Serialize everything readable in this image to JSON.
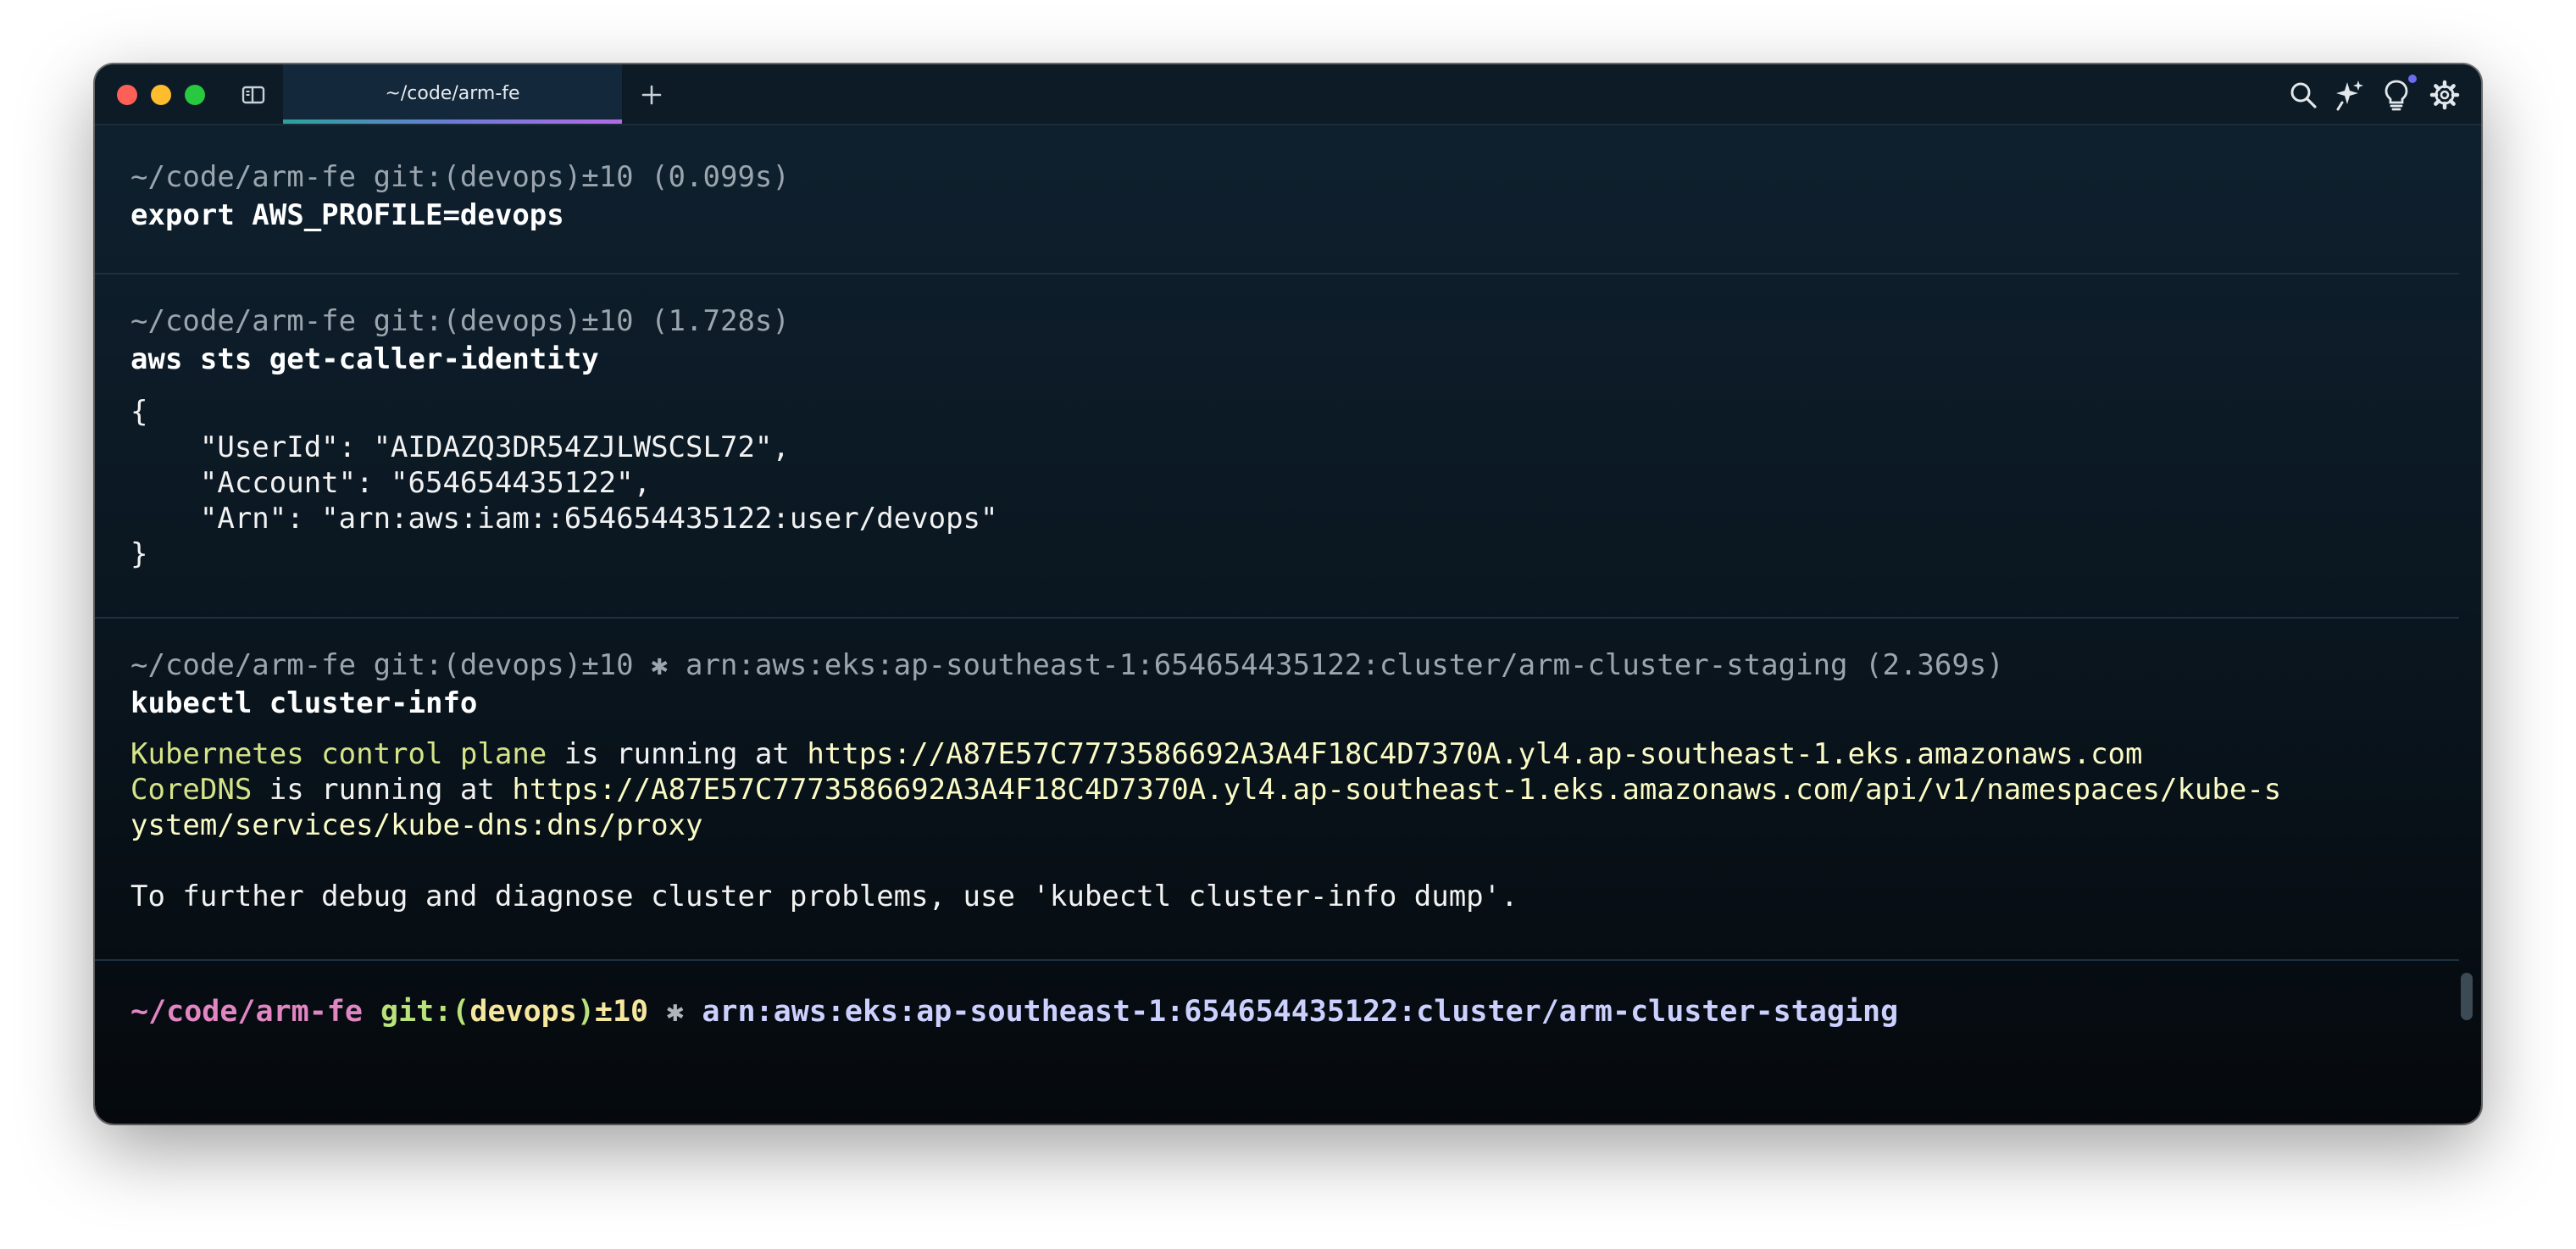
{
  "window": {
    "tab_title": "~/code/arm-fe"
  },
  "icons": {
    "sidebar": "sidebar-toggle-icon",
    "new_tab": "plus-icon",
    "search": "search-icon",
    "ai": "sparkles-icon",
    "tips": "lightbulb-icon",
    "settings": "gear-icon"
  },
  "blocks": [
    {
      "header": "~/code/arm-fe git:(devops)±10 (0.099s)",
      "command": "export AWS_PROFILE=devops"
    },
    {
      "header": "~/code/arm-fe git:(devops)±10 (1.728s)",
      "command": "aws sts get-caller-identity",
      "output": [
        "{",
        "    \"UserId\": \"AIDAZQ3DR54ZJLWSCSL72\",",
        "    \"Account\": \"654654435122\",",
        "    \"Arn\": \"arn:aws:iam::654654435122:user/devops\"",
        "}"
      ]
    },
    {
      "header": "~/code/arm-fe git:(devops)±10 ✱ arn:aws:eks:ap-southeast-1:654654435122:cluster/arm-cluster-staging (2.369s)",
      "command": "kubectl cluster-info",
      "output": {
        "line1_label": "Kubernetes control plane",
        "line1_mid": " is running at ",
        "line1_url": "https://A87E57C7773586692A3A4F18C4D7370A.yl4.ap-southeast-1.eks.amazonaws.com",
        "line2_label": "CoreDNS",
        "line2_mid": " is running at ",
        "line2_url_a": "https://A87E57C7773586692A3A4F18C4D7370A.yl4.ap-southeast-1.eks.amazonaws.com/api/v1/namespaces/kube-s",
        "line2_url_b": "ystem/services/kube-dns:dns/proxy",
        "note": "To further debug and diagnose cluster problems, use 'kubectl cluster-info dump'."
      }
    }
  ],
  "prompt": {
    "path": "~/code/arm-fe",
    "git_label": "git:(",
    "branch": "devops",
    "git_close": ")",
    "dirty": "±10",
    "star": "✱",
    "context": "arn:aws:eks:ap-southeast-1:654654435122:cluster/arm-cluster-staging"
  },
  "colors": {
    "accent_tab": "#6b7cd6",
    "prompt_path": "#e186c2",
    "prompt_git": "#b9e27a",
    "prompt_context": "#ccd0ff",
    "output_label": "#d5e489"
  }
}
